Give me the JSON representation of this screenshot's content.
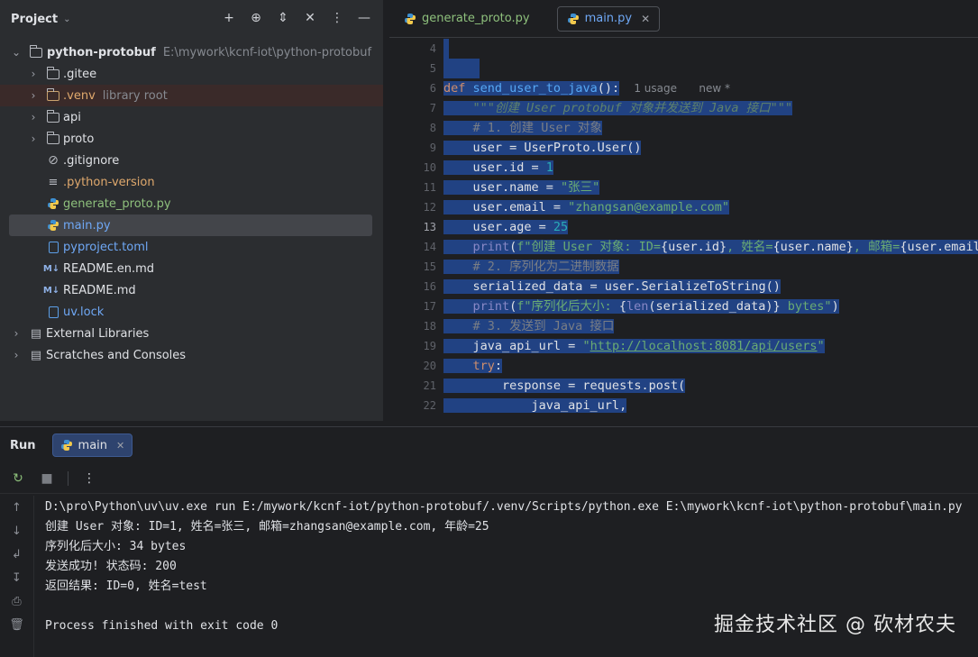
{
  "project": {
    "title": "Project",
    "root": {
      "name": "python-protobuf",
      "path": "E:\\mywork\\kcnf-iot\\python-protobuf"
    },
    "items": [
      {
        "label": ".gitee",
        "hint": ""
      },
      {
        "label": ".venv",
        "hint": "library root"
      },
      {
        "label": "api",
        "hint": ""
      },
      {
        "label": "proto",
        "hint": ""
      },
      {
        "label": ".gitignore",
        "hint": ""
      },
      {
        "label": ".python-version",
        "hint": ""
      },
      {
        "label": "generate_proto.py",
        "hint": ""
      },
      {
        "label": "main.py",
        "hint": ""
      },
      {
        "label": "pyproject.toml",
        "hint": ""
      },
      {
        "label": "README.en.md",
        "hint": ""
      },
      {
        "label": "README.md",
        "hint": ""
      },
      {
        "label": "uv.lock",
        "hint": ""
      }
    ],
    "external": "External Libraries",
    "scratches": "Scratches and Consoles"
  },
  "editor": {
    "tabs": [
      {
        "label": "generate_proto.py"
      },
      {
        "label": "main.py"
      }
    ],
    "line_numbers": [
      "4",
      "5",
      "6",
      "7",
      "8",
      "9",
      "10",
      "11",
      "12",
      "13",
      "14",
      "15",
      "16",
      "17",
      "18",
      "19",
      "20",
      "21",
      "22"
    ],
    "current_line": "13",
    "inlay_usage": "1 usage",
    "inlay_new": "new *"
  },
  "run": {
    "title": "Run",
    "tab": "main",
    "output": [
      "D:\\pro\\Python\\uv\\uv.exe run E:/mywork/kcnf-iot/python-protobuf/.venv/Scripts/python.exe E:\\mywork\\kcnf-iot\\python-protobuf\\main.py",
      "创建 User 对象: ID=1, 姓名=张三, 邮箱=zhangsan@example.com, 年龄=25",
      "序列化后大小: 34 bytes",
      "发送成功! 状态码: 200",
      "返回结果: ID=0, 姓名=test",
      "",
      "Process finished with exit code 0"
    ]
  },
  "watermark": "掘金技术社区 @ 砍材农夫",
  "colors": {
    "selection": "#214283",
    "keyword": "#cf8e6d",
    "function": "#56a8f5",
    "string": "#6aab73",
    "number": "#2aacb8"
  }
}
